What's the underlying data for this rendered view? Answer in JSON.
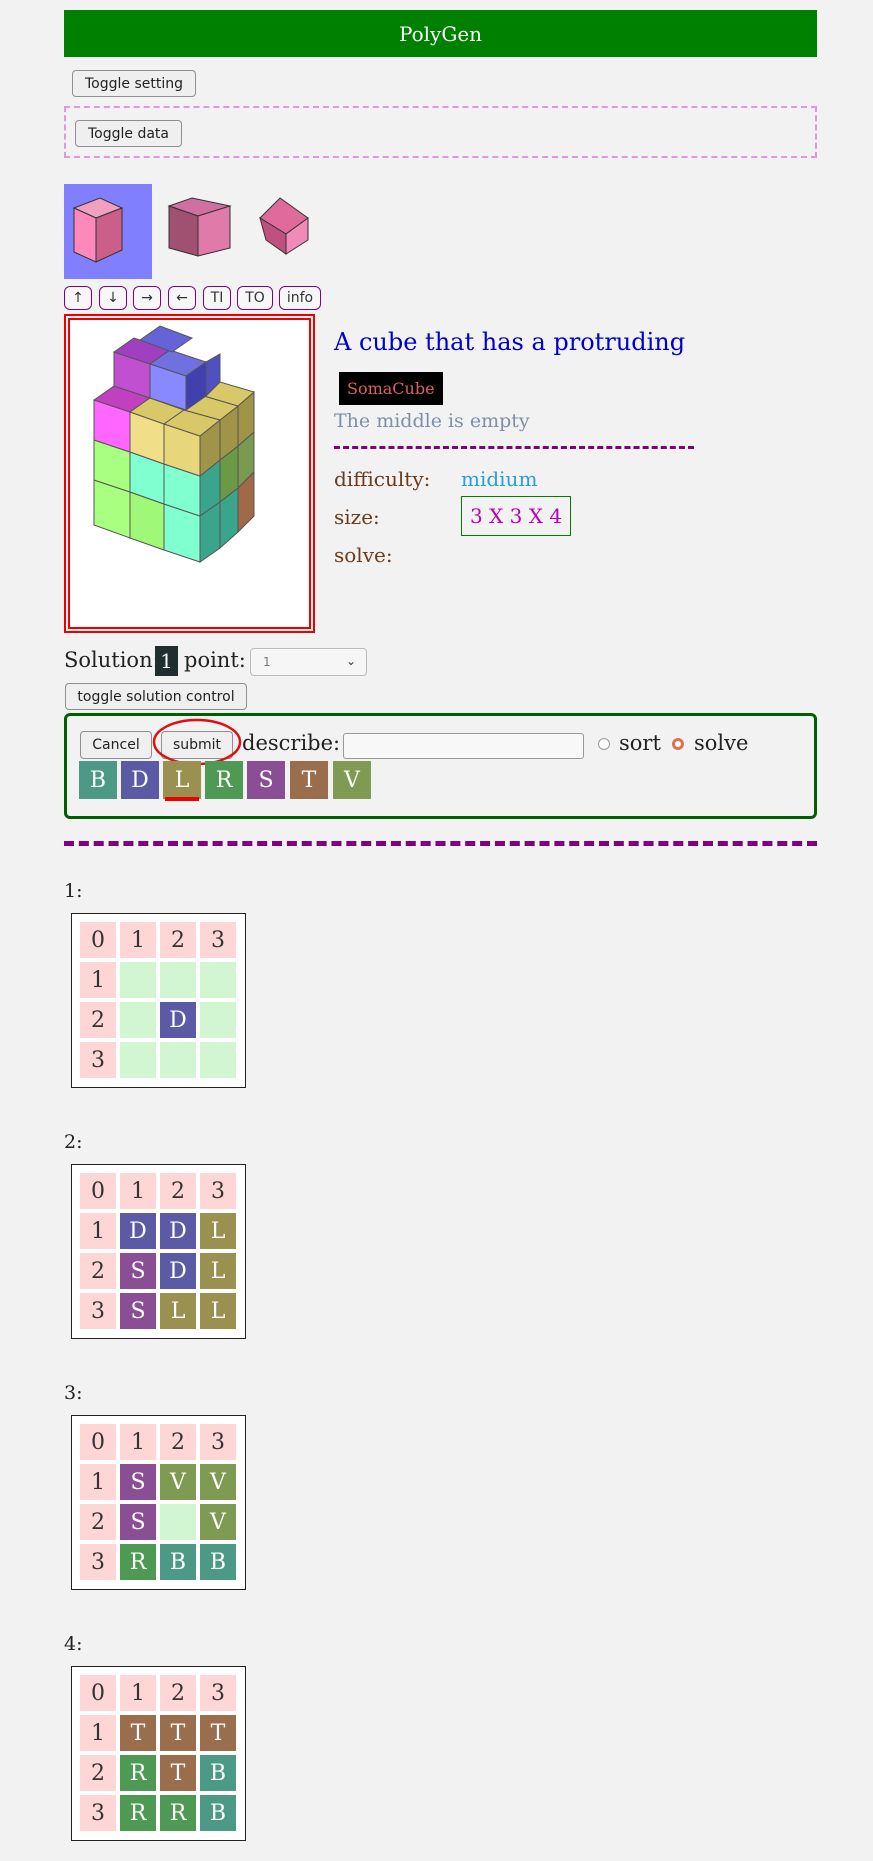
{
  "app": {
    "title": "PolyGen"
  },
  "buttons": {
    "toggle_setting": "Toggle setting",
    "toggle_data": "Toggle data",
    "toggle_solution_control": "toggle solution control",
    "cancel": "Cancel",
    "submit": "submit"
  },
  "nav_buttons": [
    "↑",
    "↓",
    "→",
    "←",
    "TI",
    "TO",
    "info"
  ],
  "puzzle": {
    "title": "A cube that has a protruding",
    "tag": "SomaCube",
    "description": "The middle is empty",
    "difficulty_label": "difficulty:",
    "difficulty_value": "midium",
    "size_label": "size:",
    "size_value": "3 X 3 X 4",
    "solve_label": "solve:"
  },
  "solution": {
    "label": "Solution:",
    "number": "1",
    "point_label": "point:",
    "point_selected": "1"
  },
  "control": {
    "describe_label": "describe:",
    "describe_value": "",
    "radio_sort": "sort",
    "radio_solve": "solve",
    "selected_mode": "solve"
  },
  "pieces": [
    {
      "letter": "B",
      "color": "#4c9a86"
    },
    {
      "letter": "D",
      "color": "#5b5aa4"
    },
    {
      "letter": "L",
      "color": "#9a9150"
    },
    {
      "letter": "R",
      "color": "#4e9a54"
    },
    {
      "letter": "S",
      "color": "#8a4e94"
    },
    {
      "letter": "T",
      "color": "#9a6d4c"
    },
    {
      "letter": "V",
      "color": "#7f9a52"
    }
  ],
  "selected_piece": "L",
  "layers": [
    {
      "title": "1:",
      "headers": [
        "0",
        "1",
        "2",
        "3"
      ],
      "rows": [
        {
          "label": "1",
          "cells": [
            "",
            "",
            ""
          ]
        },
        {
          "label": "2",
          "cells": [
            "",
            "D",
            ""
          ]
        },
        {
          "label": "3",
          "cells": [
            "",
            "",
            ""
          ]
        }
      ]
    },
    {
      "title": "2:",
      "headers": [
        "0",
        "1",
        "2",
        "3"
      ],
      "rows": [
        {
          "label": "1",
          "cells": [
            "D",
            "D",
            "L"
          ]
        },
        {
          "label": "2",
          "cells": [
            "S",
            "D",
            "L"
          ]
        },
        {
          "label": "3",
          "cells": [
            "S",
            "L",
            "L"
          ]
        }
      ]
    },
    {
      "title": "3:",
      "headers": [
        "0",
        "1",
        "2",
        "3"
      ],
      "rows": [
        {
          "label": "1",
          "cells": [
            "S",
            "V",
            "V"
          ]
        },
        {
          "label": "2",
          "cells": [
            "S",
            "",
            "V"
          ]
        },
        {
          "label": "3",
          "cells": [
            "R",
            "B",
            "B"
          ]
        }
      ]
    },
    {
      "title": "4:",
      "headers": [
        "0",
        "1",
        "2",
        "3"
      ],
      "rows": [
        {
          "label": "1",
          "cells": [
            "T",
            "T",
            "T"
          ]
        },
        {
          "label": "2",
          "cells": [
            "R",
            "T",
            "B"
          ]
        },
        {
          "label": "3",
          "cells": [
            "R",
            "R",
            "B"
          ]
        }
      ]
    }
  ],
  "colors": {
    "header_bg": "#008000",
    "accent_purple": "#800080",
    "viewer_border": "#ee0000"
  }
}
